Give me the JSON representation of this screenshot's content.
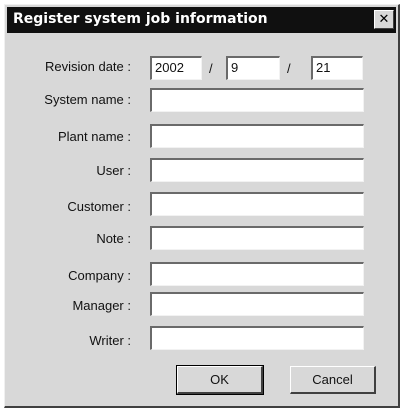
{
  "dialog": {
    "title": "Register system job information",
    "close_glyph": "✕"
  },
  "form": {
    "revision_date": {
      "label": "Revision date :",
      "year": "2002",
      "month": "9",
      "day": "21",
      "separator": "/"
    },
    "fields": [
      {
        "label": "System name :",
        "value": ""
      },
      {
        "label": "Plant name :",
        "value": ""
      },
      {
        "label": "User :",
        "value": ""
      },
      {
        "label": "Customer :",
        "value": ""
      },
      {
        "label": "Note :",
        "value": ""
      },
      {
        "label": "Company :",
        "value": ""
      },
      {
        "label": "Manager :",
        "value": ""
      },
      {
        "label": "Writer :",
        "value": ""
      }
    ]
  },
  "buttons": {
    "ok": "OK",
    "cancel": "Cancel"
  }
}
